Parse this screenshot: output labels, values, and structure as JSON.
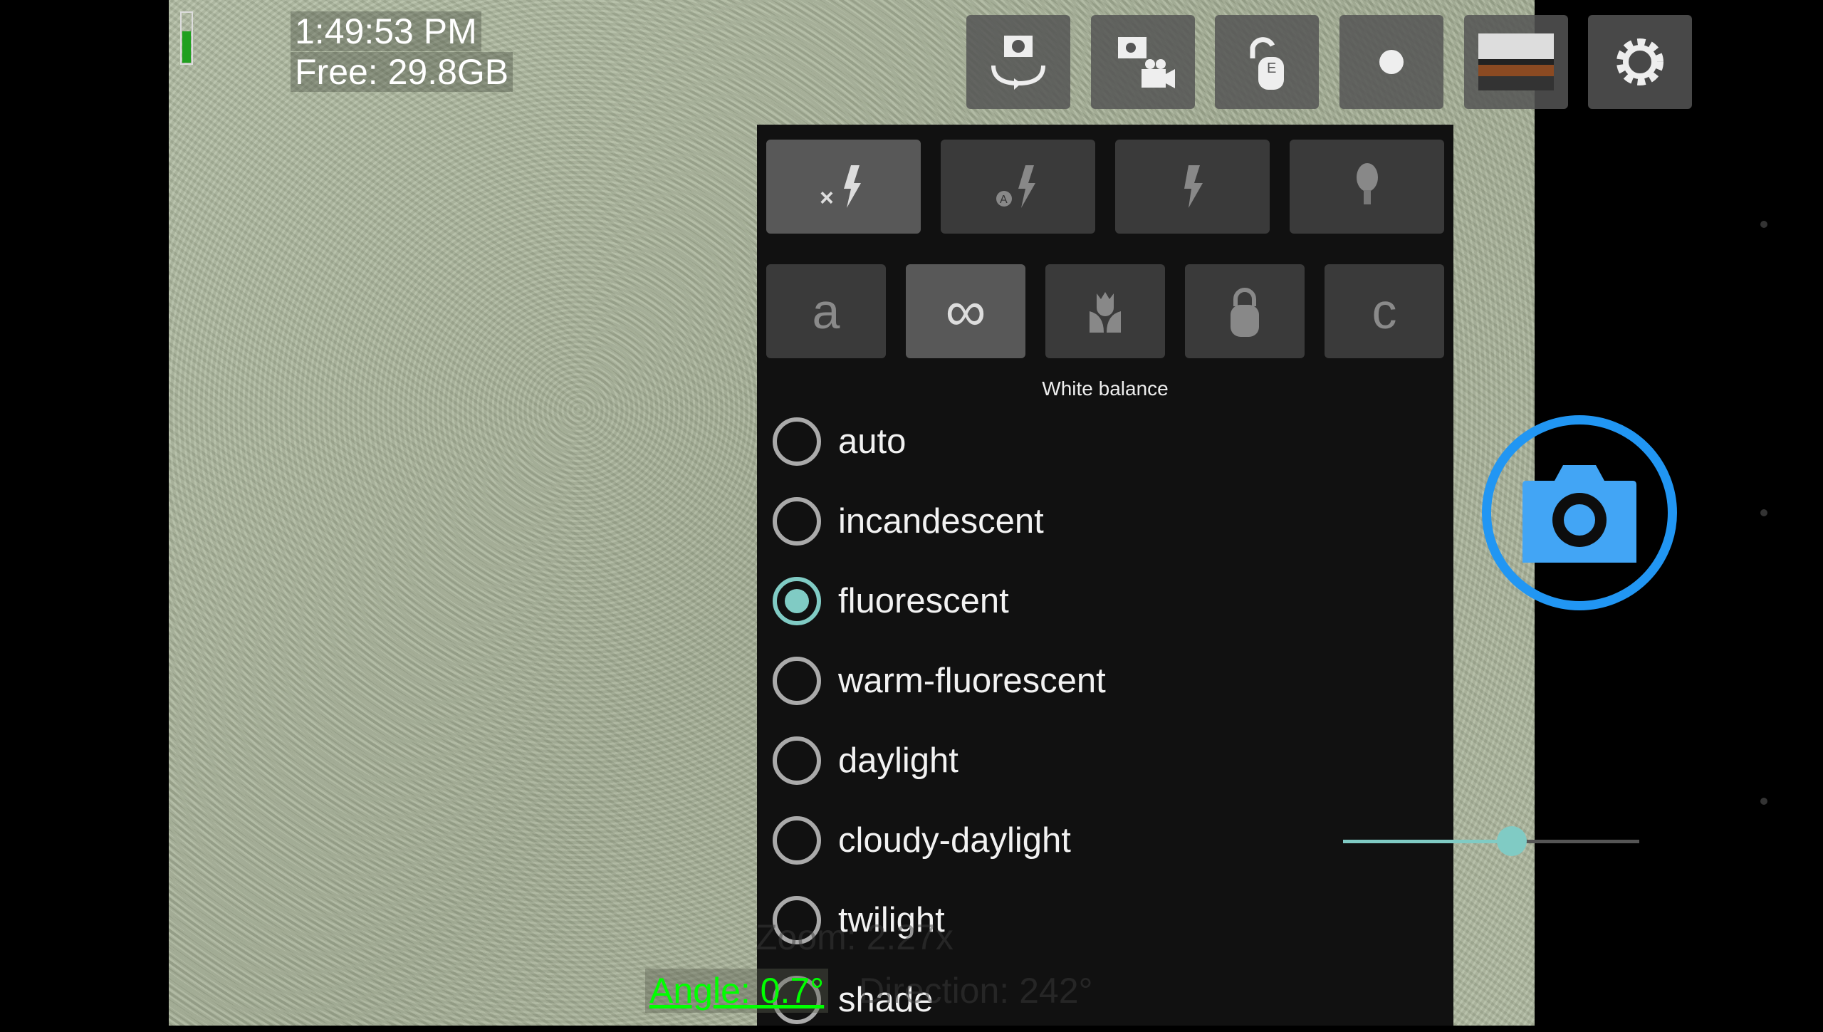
{
  "status": {
    "time": "1:49:53 PM",
    "free": "Free: 29.8GB",
    "battery_level": 0.62,
    "battery_color": "#20a020"
  },
  "top_buttons": [
    {
      "name": "switch-camera-icon"
    },
    {
      "name": "photo-video-mode-icon"
    },
    {
      "name": "exposure-lock-icon"
    },
    {
      "name": "record-dot-icon"
    },
    {
      "name": "gallery-thumbnail"
    },
    {
      "name": "settings-gear-icon"
    }
  ],
  "flash_modes": [
    {
      "icon": "flash-off-icon",
      "selected": true
    },
    {
      "icon": "flash-auto-icon"
    },
    {
      "icon": "flash-on-icon"
    },
    {
      "icon": "torch-bulb-icon"
    }
  ],
  "focus_modes": [
    {
      "label": "a",
      "icon": "focus-auto"
    },
    {
      "label": "∞",
      "icon": "focus-infinity",
      "selected": true
    },
    {
      "icon": "focus-macro-icon"
    },
    {
      "icon": "focus-locked-icon"
    },
    {
      "label": "c",
      "icon": "focus-continuous"
    }
  ],
  "white_balance": {
    "title": "White balance",
    "selected": "fluorescent",
    "options": [
      "auto",
      "incandescent",
      "fluorescent",
      "warm-fluorescent",
      "daylight",
      "cloudy-daylight",
      "twilight",
      "shade"
    ]
  },
  "overlay": {
    "zoom": "Zoom: 2.27x",
    "angle": "Angle: 0.7°",
    "direction": "Direction: 242°"
  },
  "zoom_slider": {
    "value": 0.57
  },
  "colors": {
    "accent": "#80cbc4",
    "shutter": "#2196f3",
    "angle": "#00ff00"
  }
}
